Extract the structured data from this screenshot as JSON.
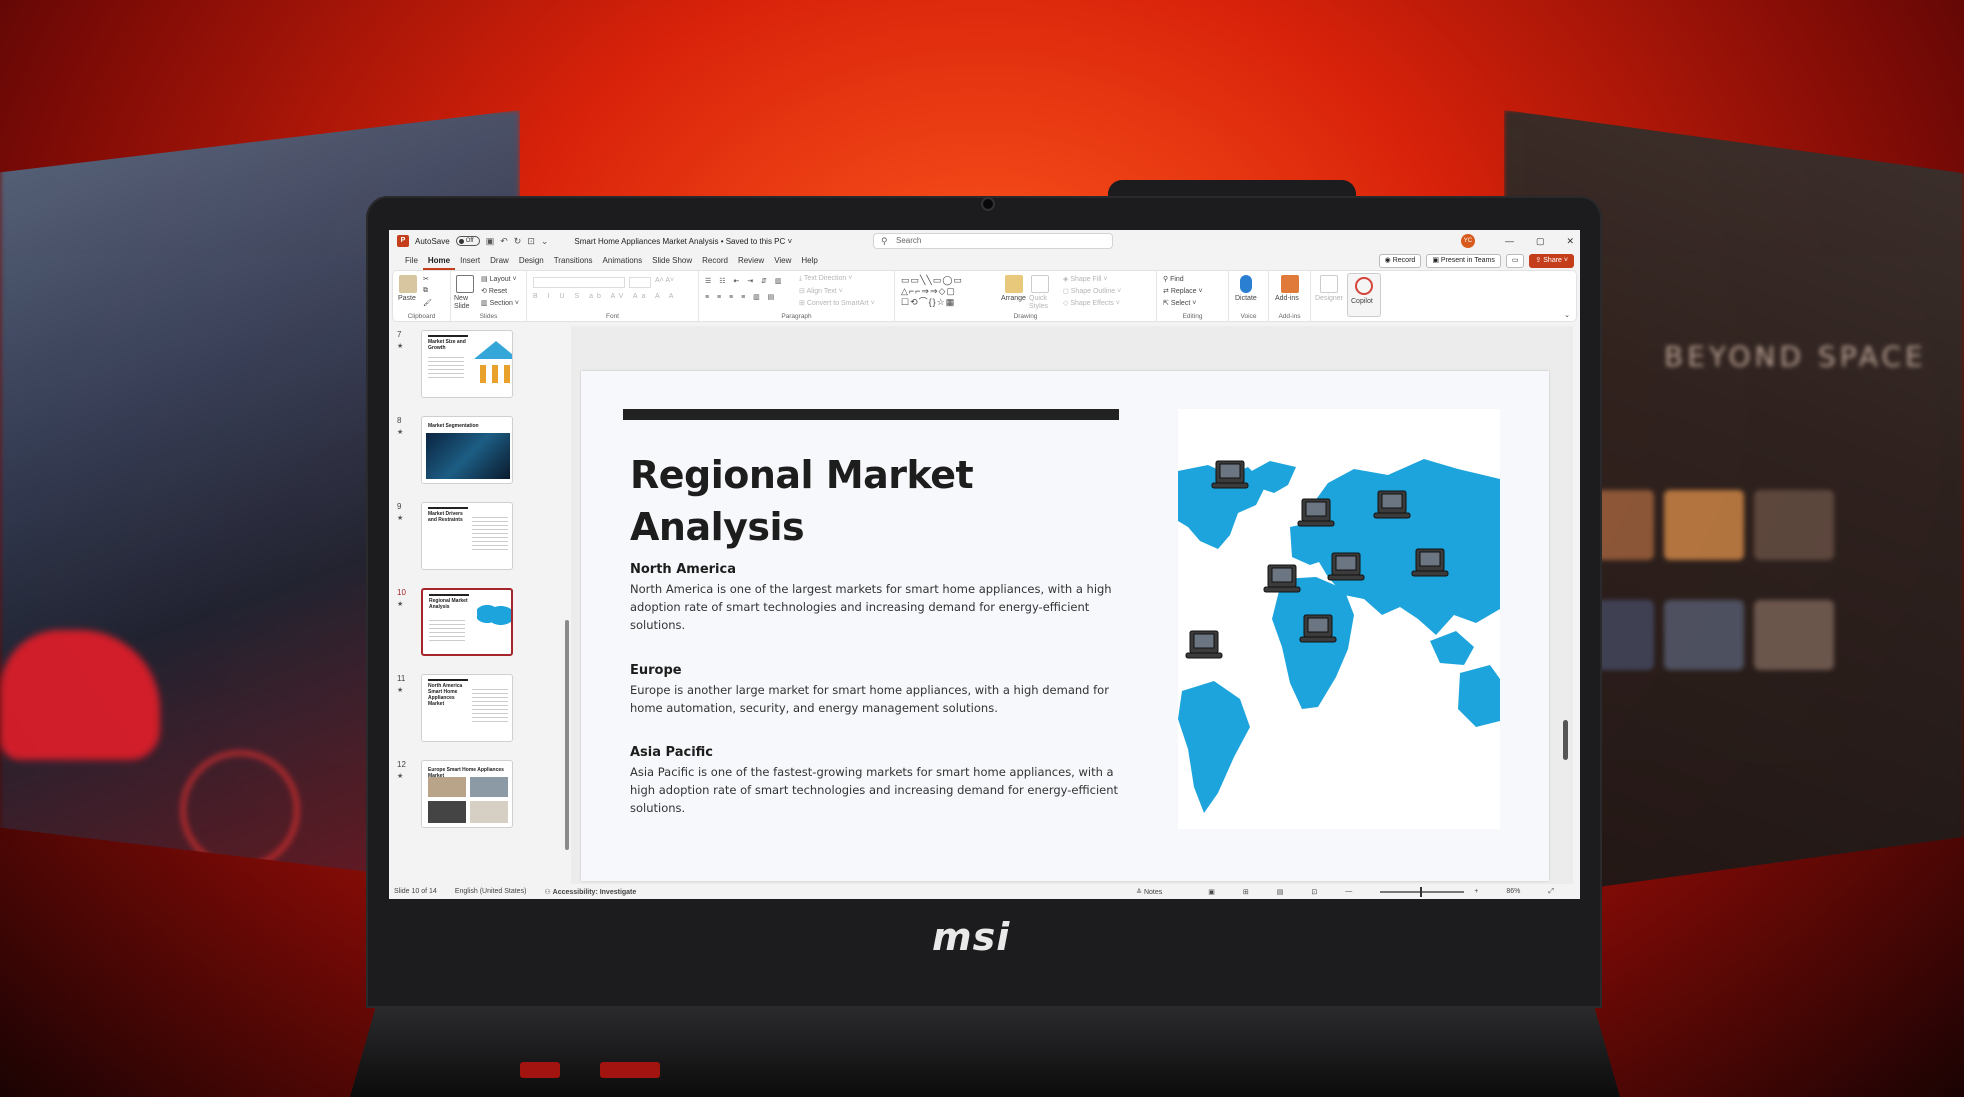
{
  "background": {
    "accent": "#d8220a",
    "brand_logo": "msi"
  },
  "side_right": {
    "headline": "BEYOND SPACE"
  },
  "app": {
    "autosave_label": "AutoSave",
    "autosave_state": "Off",
    "doc_title": "Smart Home Appliances Market Analysis • Saved to this PC ˅",
    "search_placeholder": "Search",
    "user_initials": "YC"
  },
  "menu": {
    "tabs": [
      "File",
      "Home",
      "Insert",
      "Draw",
      "Design",
      "Transitions",
      "Animations",
      "Slide Show",
      "Record",
      "Review",
      "View",
      "Help"
    ],
    "active": "Home",
    "record": "Record",
    "present": "Present in Teams",
    "share": "Share"
  },
  "ribbon": {
    "clipboard": {
      "paste": "Paste",
      "name": "Clipboard"
    },
    "slides": {
      "new_slide": "New Slide",
      "layout": "Layout",
      "reset": "Reset",
      "section": "Section",
      "name": "Slides"
    },
    "font": {
      "name": "Font"
    },
    "paragraph": {
      "text_direction": "Text Direction",
      "align_text": "Align Text",
      "smartart": "Convert to SmartArt",
      "name": "Paragraph"
    },
    "drawing": {
      "arrange": "Arrange",
      "quick_styles": "Quick Styles",
      "shape_fill": "Shape Fill",
      "shape_outline": "Shape Outline",
      "shape_effects": "Shape Effects",
      "name": "Drawing"
    },
    "editing": {
      "find": "Find",
      "replace": "Replace",
      "select": "Select",
      "name": "Editing"
    },
    "voice": {
      "dictate": "Dictate",
      "name": "Voice"
    },
    "addins": {
      "addins": "Add-ins",
      "name": "Add-ins"
    },
    "designer": "Designer",
    "copilot": "Copilot"
  },
  "thumbnails": [
    {
      "num": "7",
      "title": "Market Size and Growth"
    },
    {
      "num": "8",
      "title": "Market Segmentation"
    },
    {
      "num": "9",
      "title": "Market Drivers and Restraints"
    },
    {
      "num": "10",
      "title": "Regional Market Analysis",
      "active": true
    },
    {
      "num": "11",
      "title": "North America Smart Home Appliances Market"
    },
    {
      "num": "12",
      "title": "Europe Smart Home Appliances Market"
    }
  ],
  "slide": {
    "title": "Regional Market Analysis",
    "sections": [
      {
        "heading": "North America",
        "body": "North America is one of the largest markets for smart home appliances, with a high adoption rate of smart technologies and increasing demand for energy-efficient solutions."
      },
      {
        "heading": "Europe",
        "body": "Europe is another large market for smart home appliances, with a high demand for home automation, security, and energy management solutions."
      },
      {
        "heading": "Asia Pacific",
        "body": "Asia Pacific is one of the fastest-growing markets for smart home appliances, with a high adoption rate of smart technologies and increasing demand for energy-efficient solutions."
      }
    ],
    "map_color": "#1da4dc"
  },
  "status": {
    "slide_count": "Slide 10 of 14",
    "language": "English (United States)",
    "accessibility": "Accessibility: Investigate",
    "notes": "Notes",
    "zoom": "86%"
  }
}
